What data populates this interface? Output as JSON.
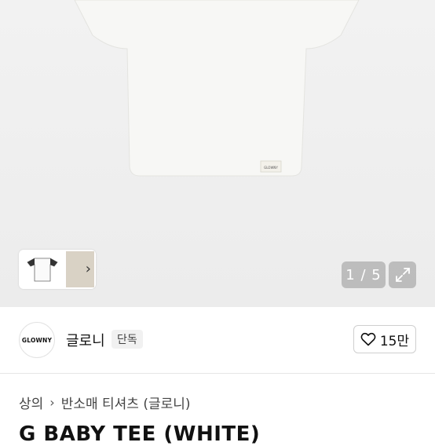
{
  "gallery": {
    "tag_text": "GLOWNY",
    "counter": "1 / 5",
    "thumb_next_icon": "chevron-right-icon",
    "expand_icon": "expand-icon"
  },
  "brand": {
    "logo_text": "GLOWNY",
    "name": "글로니",
    "badge": "단독",
    "like_icon": "heart-icon",
    "like_count": "15만"
  },
  "breadcrumb": {
    "items": [
      "상의",
      "반소매 티셔츠 (글로니)"
    ],
    "separator_icon": "chevron-right-icon"
  },
  "product": {
    "title": "G BABY TEE (WHITE)"
  }
}
